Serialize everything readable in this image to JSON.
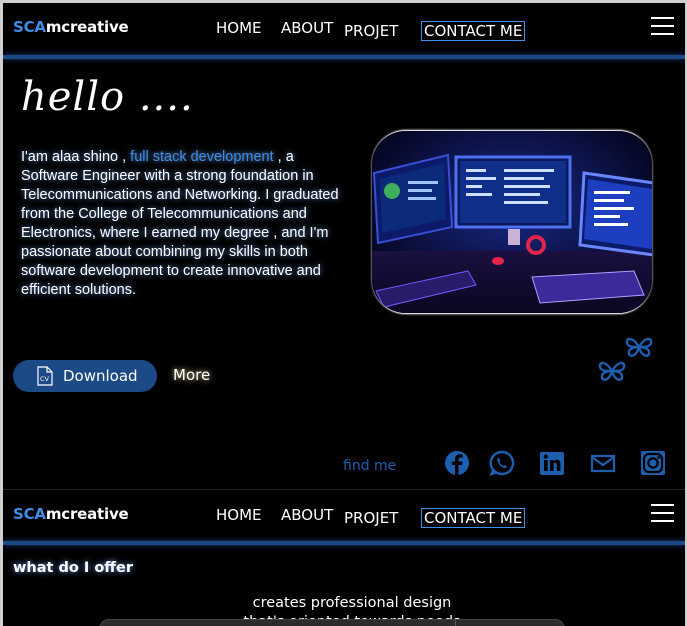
{
  "brand": {
    "part1": "SCA",
    "part2": "mcreative"
  },
  "nav": {
    "home": "HOME",
    "about": "ABOUT",
    "projet": "PROJET",
    "contact": "CONTACT ME"
  },
  "hero": {
    "greeting": "hello ....",
    "intro_before": "I'am alaa shino ,",
    "intro_highlight": "full stack development",
    "intro_after": ", a Software Engineer with a strong foundation in Telecommunications and Networking. I graduated from the College of Telecommunications and Electronics, where I earned my degree ,  and I'm passionate about combining my skills in both software development to create innovative and efficient solutions.",
    "download_label": "Download",
    "cv_icon_text": "CV",
    "more_label": "More"
  },
  "social": {
    "find_me": "find me",
    "icons": [
      "facebook-icon",
      "whatsapp-icon",
      "linkedin-icon",
      "mail-icon",
      "instagram-icon"
    ]
  },
  "offer": {
    "title": "what do I offer",
    "tagline": "creates professional design that's oriented towards needs"
  },
  "colors": {
    "accent": "#3d8ee6",
    "nav_bar": "#1d4a86",
    "button": "#1b4a86",
    "background": "#000000"
  }
}
